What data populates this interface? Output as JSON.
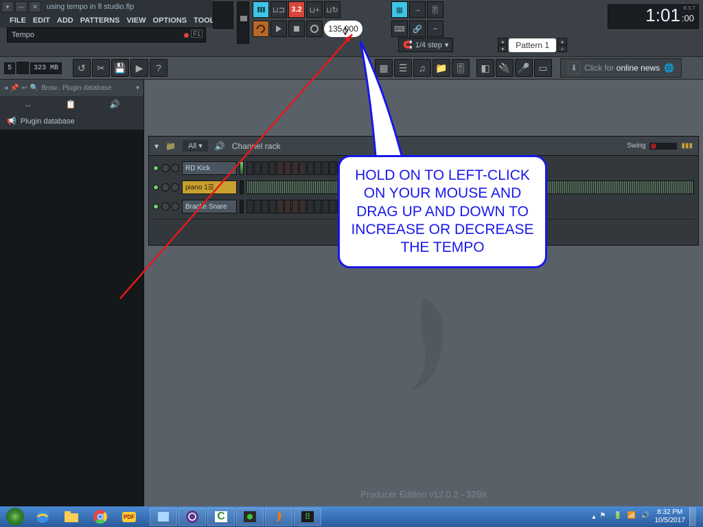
{
  "project_file": "using tempo in fl studio.flp",
  "menu": [
    "FILE",
    "EDIT",
    "ADD",
    "PATTERNS",
    "VIEW",
    "OPTIONS",
    "TOOLS"
  ],
  "hint": {
    "text": "Tempo",
    "hotkey": "F1"
  },
  "transport": {
    "counter": "3.2",
    "tempo": "135.000",
    "snap": "1/4 step",
    "pattern": "Pattern 1"
  },
  "time": {
    "bar": "1",
    "beat": "01",
    "tick": ":00",
    "label": "B.S.T"
  },
  "stats": {
    "cpu": "5",
    "mem": "323 MB"
  },
  "news": {
    "prefix": "Click for ",
    "link": "online news"
  },
  "sidebar": {
    "breadcrumb": "Brow.. Plugin database",
    "item": "Plugin database"
  },
  "channel_rack": {
    "title": "Channel rack",
    "filter": "All",
    "swing_label": "Swing",
    "channels": [
      {
        "name": "RD Kick",
        "selected": false
      },
      {
        "name": "piano 1",
        "selected": true
      },
      {
        "name": "Bracke Snare",
        "selected": false
      }
    ],
    "add": "+"
  },
  "version": "Producer Edition v12.0.2 - 32Bit",
  "callout": "HOLD ON TO LEFT-CLICK ON YOUR MOUSE AND DRAG UP AND DOWN TO INCREASE OR DECREASE THE TEMPO",
  "taskbar": {
    "time": "8:32 PM",
    "date": "10/5/2017"
  }
}
